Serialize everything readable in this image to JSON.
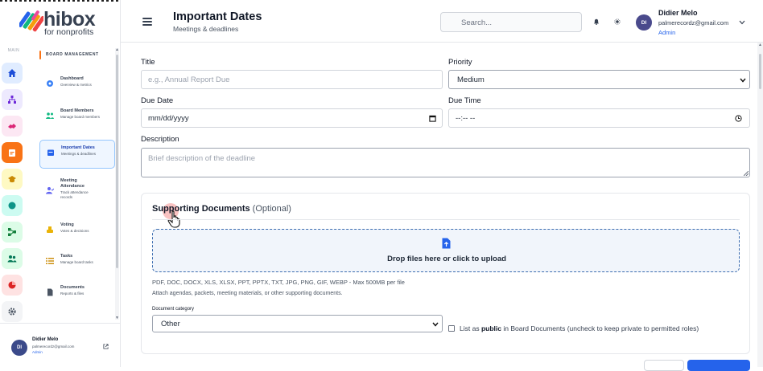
{
  "brand": {
    "name": "hibox",
    "tagline": "for nonprofits"
  },
  "rail": {
    "section_label": "MAIN"
  },
  "sidebar": {
    "section_title": "BOARD MANAGEMENT",
    "items": [
      {
        "title": "Dashboard",
        "subtitle": "Overview & metrics"
      },
      {
        "title": "Board Members",
        "subtitle": "Manage board members"
      },
      {
        "title": "Important Dates",
        "subtitle": "Meetings & deadlines"
      },
      {
        "title": "Meeting Attendance",
        "subtitle": "Track attendance records"
      },
      {
        "title": "Voting",
        "subtitle": "Votes & decisions"
      },
      {
        "title": "Tasks",
        "subtitle": "Manage board tasks"
      },
      {
        "title": "Documents",
        "subtitle": "Reports & files"
      }
    ],
    "footer_user": {
      "initials": "DI",
      "name": "Didier Melo",
      "email": "palmerecordz@gmail.com",
      "role": "Admin"
    }
  },
  "header": {
    "title": "Important Dates",
    "subtitle": "Meetings & deadlines",
    "search_placeholder": "Search...",
    "user": {
      "initials": "DI",
      "name": "Didier Melo",
      "email": "palmerecordz@gmail.com",
      "role": "Admin"
    }
  },
  "form": {
    "title_label": "Title",
    "title_placeholder": "e.g., Annual Report Due",
    "priority_label": "Priority",
    "priority_value": "Medium",
    "due_date_label": "Due Date",
    "due_date_value": "mm/dd/yyyy",
    "due_time_label": "Due Time",
    "due_time_value": "--:-- --",
    "description_label": "Description",
    "description_placeholder": "Brief description of the deadline"
  },
  "documents": {
    "heading": "Supporting Documents",
    "heading_note": "(Optional)",
    "drop_text": "Drop files here or click to upload",
    "formats": "PDF, DOC, DOCX, XLS, XLSX, PPT, PPTX, TXT, JPG, PNG, GIF, WEBP - Max 500MB per file",
    "hint": "Attach agendas, packets, meeting materials, or other supporting documents.",
    "category_label": "Document category",
    "category_value": "Other",
    "public_prefix": "List as",
    "public_bold": "public",
    "public_suffix": "in Board Documents (uncheck to keep private to permitted roles)"
  },
  "colors": {
    "accent": "#2563eb",
    "brand_orange": "#f97316",
    "active_bg": "#eff6ff"
  }
}
